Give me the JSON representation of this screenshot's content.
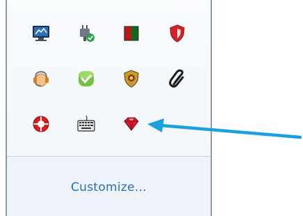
{
  "tray_flyout": {
    "rows": [
      [
        {
          "icon": "network-monitor-icon"
        },
        {
          "icon": "power-plug-check-icon"
        },
        {
          "icon": "red-green-block-icon"
        },
        {
          "icon": "security-shield-icon"
        }
      ],
      [
        {
          "icon": "headset-support-icon"
        },
        {
          "icon": "green-check-icon"
        },
        {
          "icon": "gold-shield-icon"
        },
        {
          "icon": "paperclip-icon"
        }
      ],
      [
        {
          "icon": "red-lifebuoy-icon"
        },
        {
          "icon": "keyboard-icon"
        },
        {
          "icon": "red-gem-icon"
        }
      ]
    ],
    "customize_label": "Customize..."
  },
  "colors": {
    "link": "#2a6fb3",
    "arrow": "#1aa0e0",
    "flyout_border": "#8d98a7"
  }
}
